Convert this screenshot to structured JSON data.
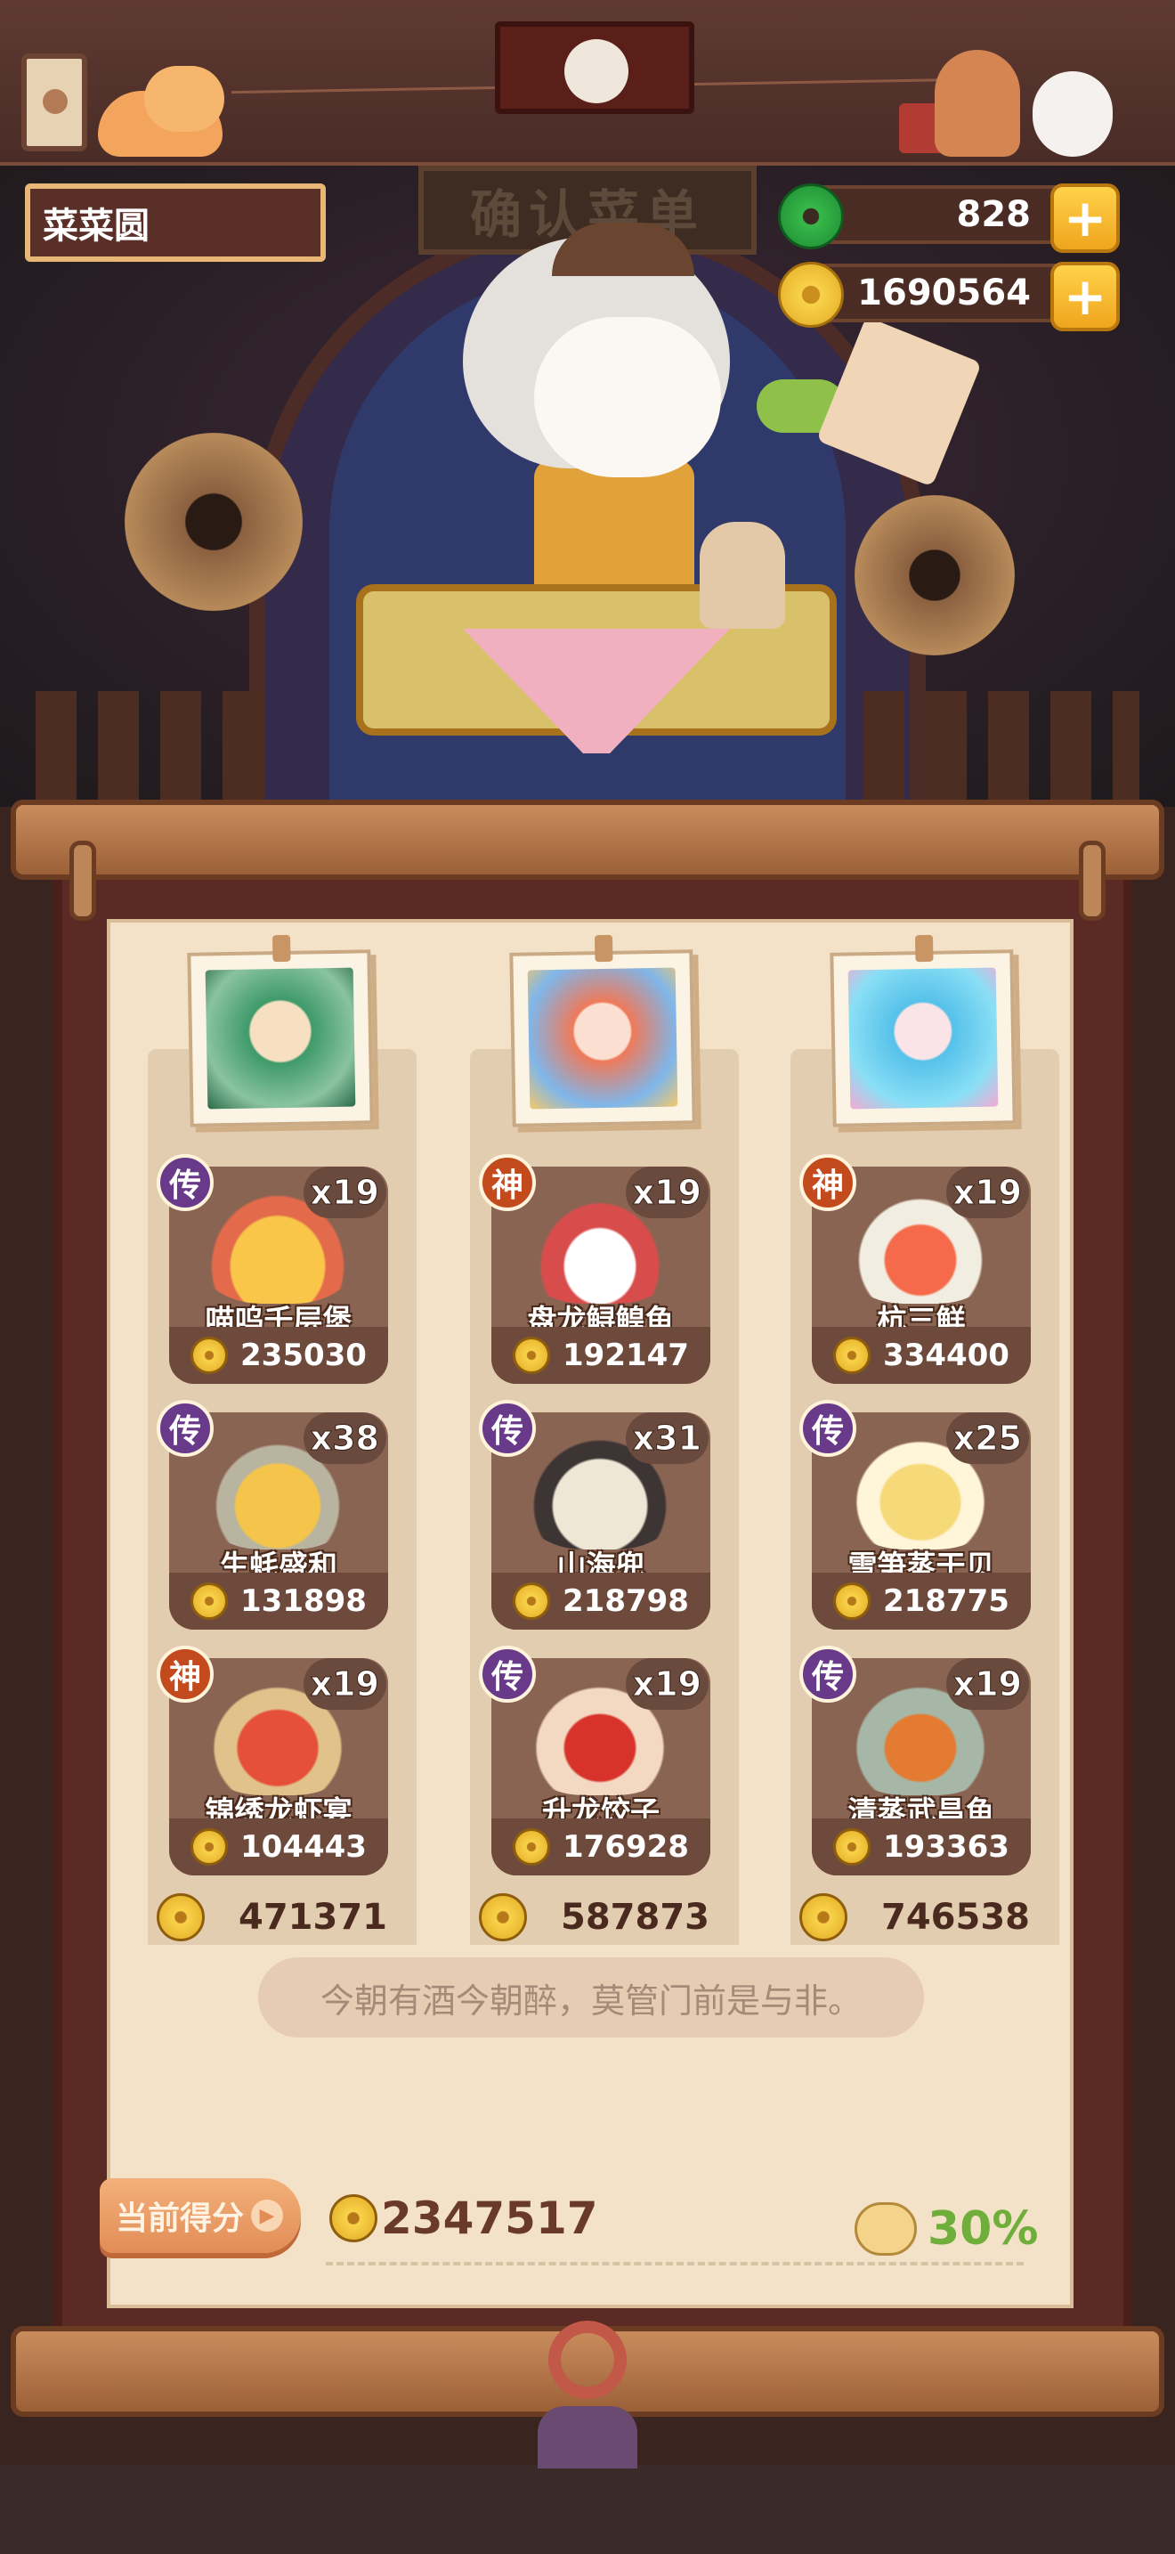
{
  "player": {
    "name": "菜菜圆"
  },
  "currency": {
    "jade": {
      "value": "828",
      "icon": "jade-coin-icon"
    },
    "coins": {
      "value": "1690564",
      "icon": "gold-coin-icon"
    },
    "add_label": "+"
  },
  "scene": {
    "plaque_text": "确认菜单"
  },
  "customers": [
    {
      "total": "471371",
      "dishes": [
        {
          "badge": "传",
          "qty": "x19",
          "name": "喵呜千层堡",
          "price": "235030"
        },
        {
          "badge": "传",
          "qty": "x38",
          "name": "生蚝盛和",
          "price": "131898"
        },
        {
          "badge": "神",
          "qty": "x19",
          "name": "锦绣龙虾宴",
          "price": "104443"
        }
      ]
    },
    {
      "total": "587873",
      "dishes": [
        {
          "badge": "神",
          "qty": "x19",
          "name": "盘龙鲟鳇鱼",
          "price": "192147"
        },
        {
          "badge": "传",
          "qty": "x31",
          "name": "山海兜",
          "price": "218798"
        },
        {
          "badge": "传",
          "qty": "x19",
          "name": "升龙饺子",
          "price": "176928"
        }
      ]
    },
    {
      "total": "746538",
      "dishes": [
        {
          "badge": "神",
          "qty": "x19",
          "name": "杭三鲜",
          "price": "334400"
        },
        {
          "badge": "传",
          "qty": "x25",
          "name": "雪笋蒸干贝",
          "price": "218775"
        },
        {
          "badge": "传",
          "qty": "x19",
          "name": "清蒸武昌鱼",
          "price": "193363"
        }
      ]
    }
  ],
  "quote": "今朝有酒今朝醉，莫管门前是与非。",
  "score": {
    "button_label": "当前得分",
    "total": "2347517",
    "bonus_percent": "30%"
  },
  "colors": {
    "legendary_badge": "#6a3a8a",
    "divine_badge": "#c24a1c",
    "bonus_green": "#6fae3a",
    "parchment": "#f3e2c8"
  }
}
